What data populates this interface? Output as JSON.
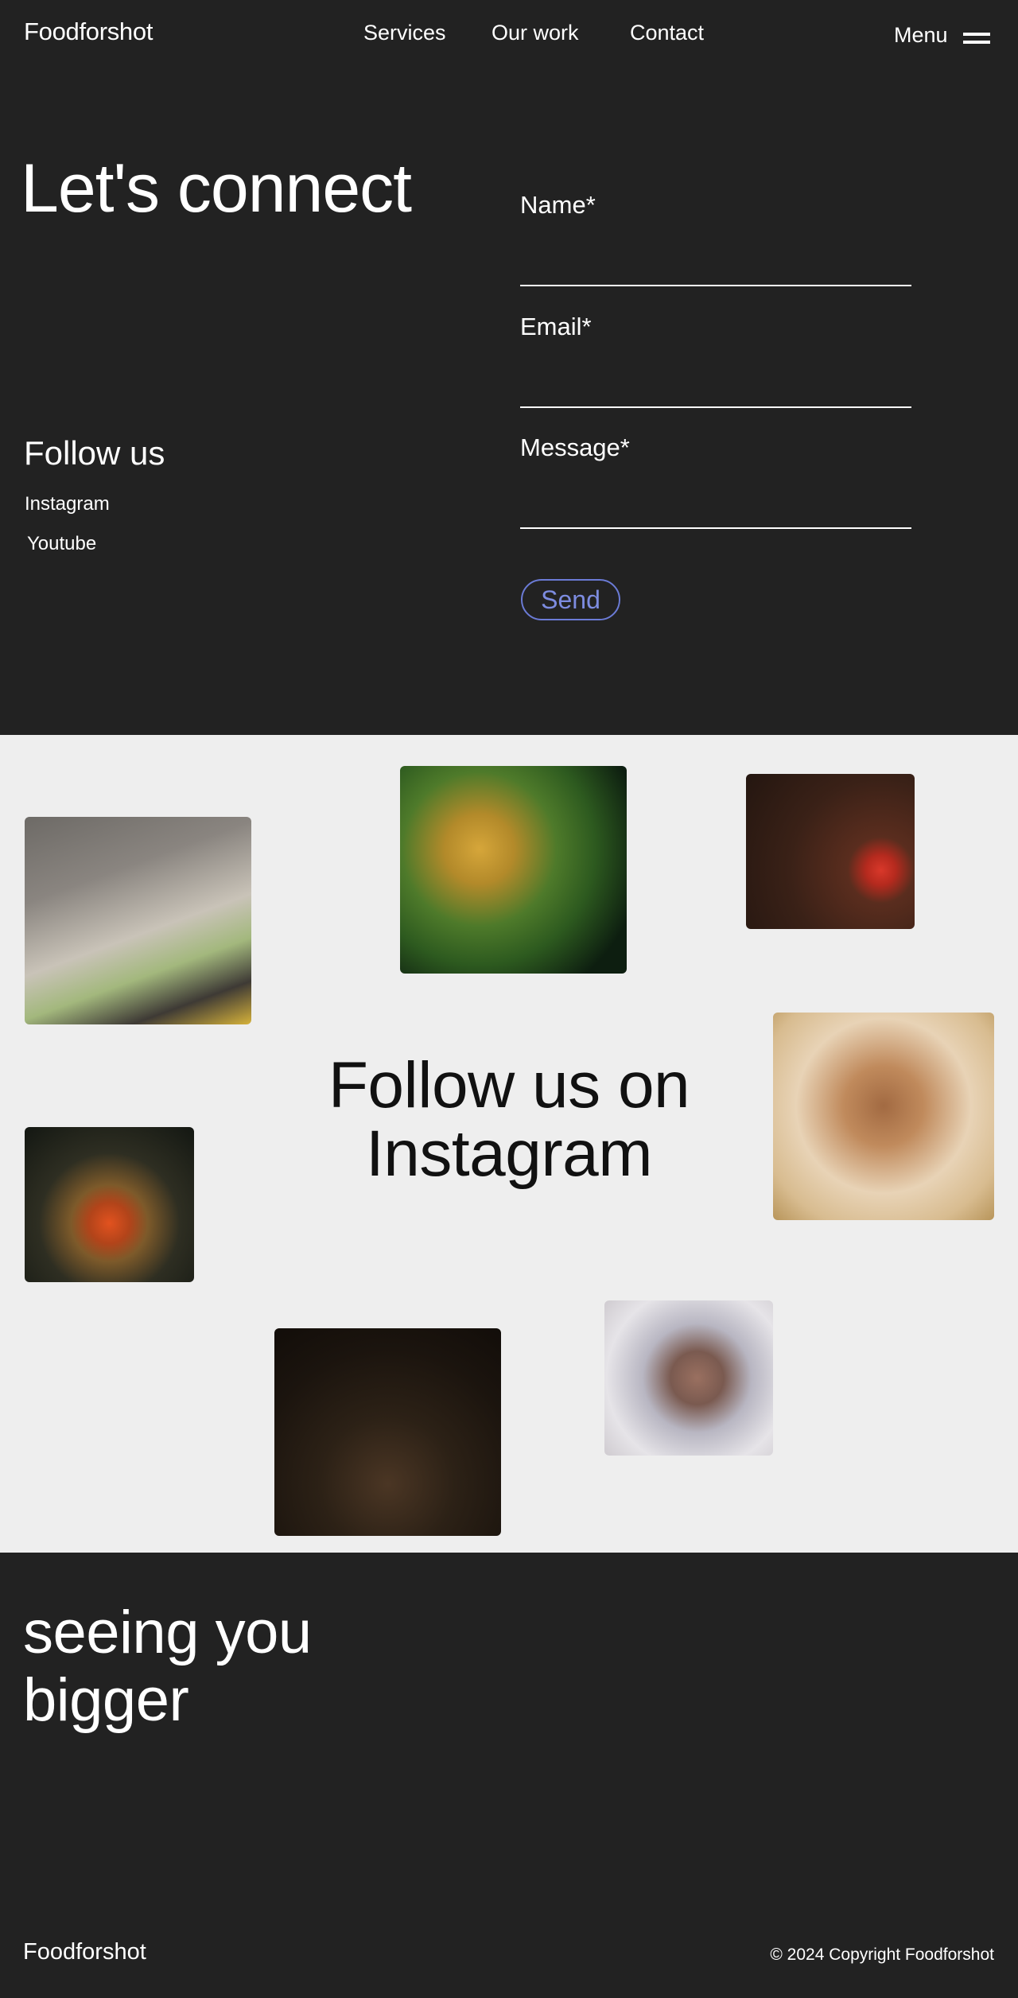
{
  "header": {
    "logo": "Foodforshot",
    "nav": [
      {
        "label": "Services"
      },
      {
        "label": "Our work"
      },
      {
        "label": "Contact"
      }
    ],
    "menu_label": "Menu"
  },
  "contact": {
    "title": "Let's connect",
    "follow_title": "Follow us",
    "social": [
      {
        "label": "Instagram"
      },
      {
        "label": "Youtube"
      }
    ],
    "form": {
      "name_label": "Name*",
      "name_value": "",
      "email_label": "Email*",
      "email_value": "",
      "message_label": "Message*",
      "message_value": "",
      "send_label": "Send"
    }
  },
  "gallery": {
    "title_line1": "Follow us on",
    "title_line2": "Instagram"
  },
  "footer": {
    "slogan_line1": "seeing you",
    "slogan_line2": "bigger",
    "logo": "Foodforshot",
    "copyright": "© 2024 Copyright Foodforshot"
  },
  "colors": {
    "background_dark": "#222222",
    "background_light": "#eeeeee",
    "accent": "#6b7bd6",
    "text_light": "#ffffff",
    "text_dark": "#111111"
  }
}
